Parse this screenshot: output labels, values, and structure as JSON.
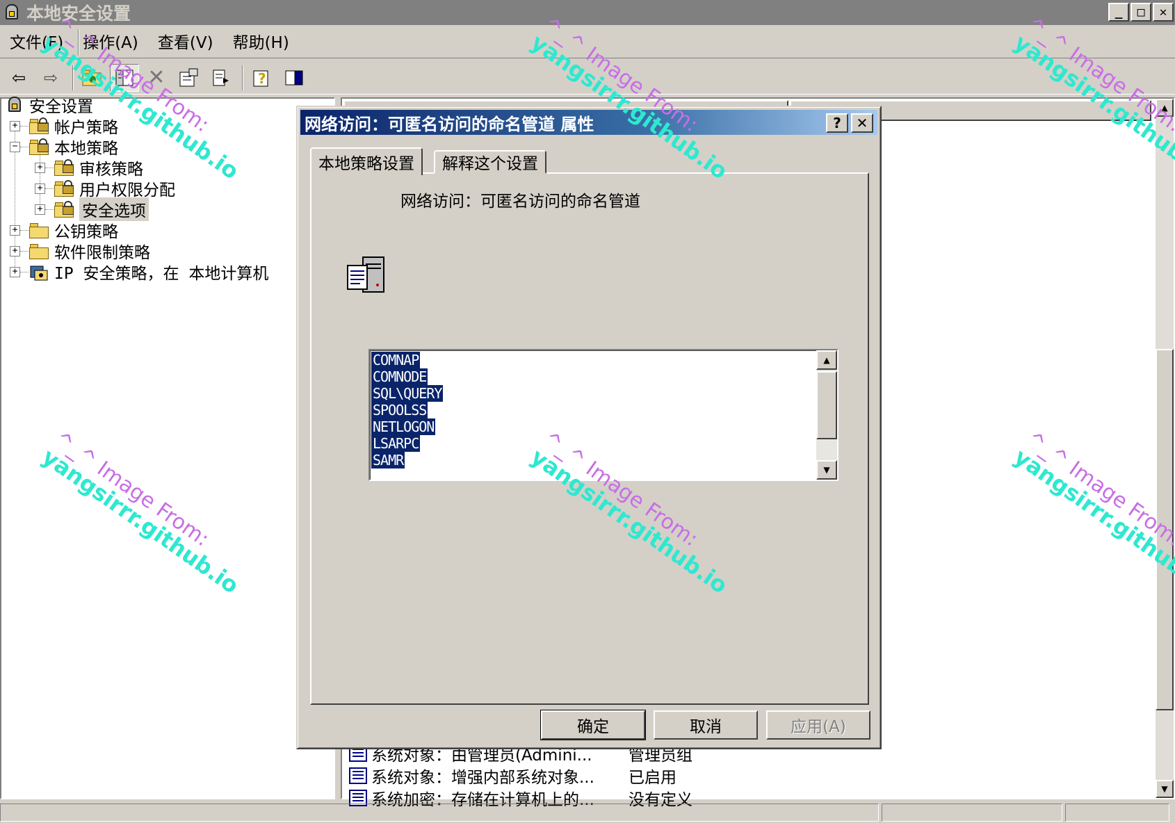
{
  "window": {
    "title": "本地安全设置"
  },
  "menu": [
    "文件(F)",
    "操作(A)",
    "查看(V)",
    "帮助(H)"
  ],
  "tree": {
    "root": "安全设置",
    "account": "帐户策略",
    "local": "本地策略",
    "audit": "审核策略",
    "rights": "用户权限分配",
    "secopt": "安全选项",
    "pubkey": "公钥策略",
    "software": "软件限制策略",
    "ipsec": "IP 安全策略，在 本地计算机"
  },
  "list": {
    "rows": [
      {
        "policy": "系统对象：由管理员(Admini...",
        "value": "管理员组"
      },
      {
        "policy": "系统对象：增强内部系统对象...",
        "value": "已启用"
      },
      {
        "policy": "系统加密：存储在计算机上的...",
        "value": "没有定义"
      }
    ]
  },
  "dialog": {
    "title": "网络访问：可匿名访问的命名管道 属性",
    "help_btn": "?",
    "close_btn": "✕",
    "tab_local": "本地策略设置",
    "tab_explain": "解释这个设置",
    "heading": "网络访问：可匿名访问的命名管道",
    "pipes": [
      "COMNAP",
      "COMNODE",
      "SQL\\QUERY",
      "SPOOLSS",
      "NETLOGON",
      "LSARPC",
      "SAMR"
    ],
    "ok": "确定",
    "cancel": "取消",
    "apply": "应用(A)"
  },
  "watermark": {
    "line1": "^_^ Image From:",
    "line2": "yangsirrr.github.io"
  },
  "colors": {
    "title_active": "#0a246a",
    "title_inactive": "#808080",
    "face": "#d4d0c8",
    "selection": "#0a246a"
  }
}
